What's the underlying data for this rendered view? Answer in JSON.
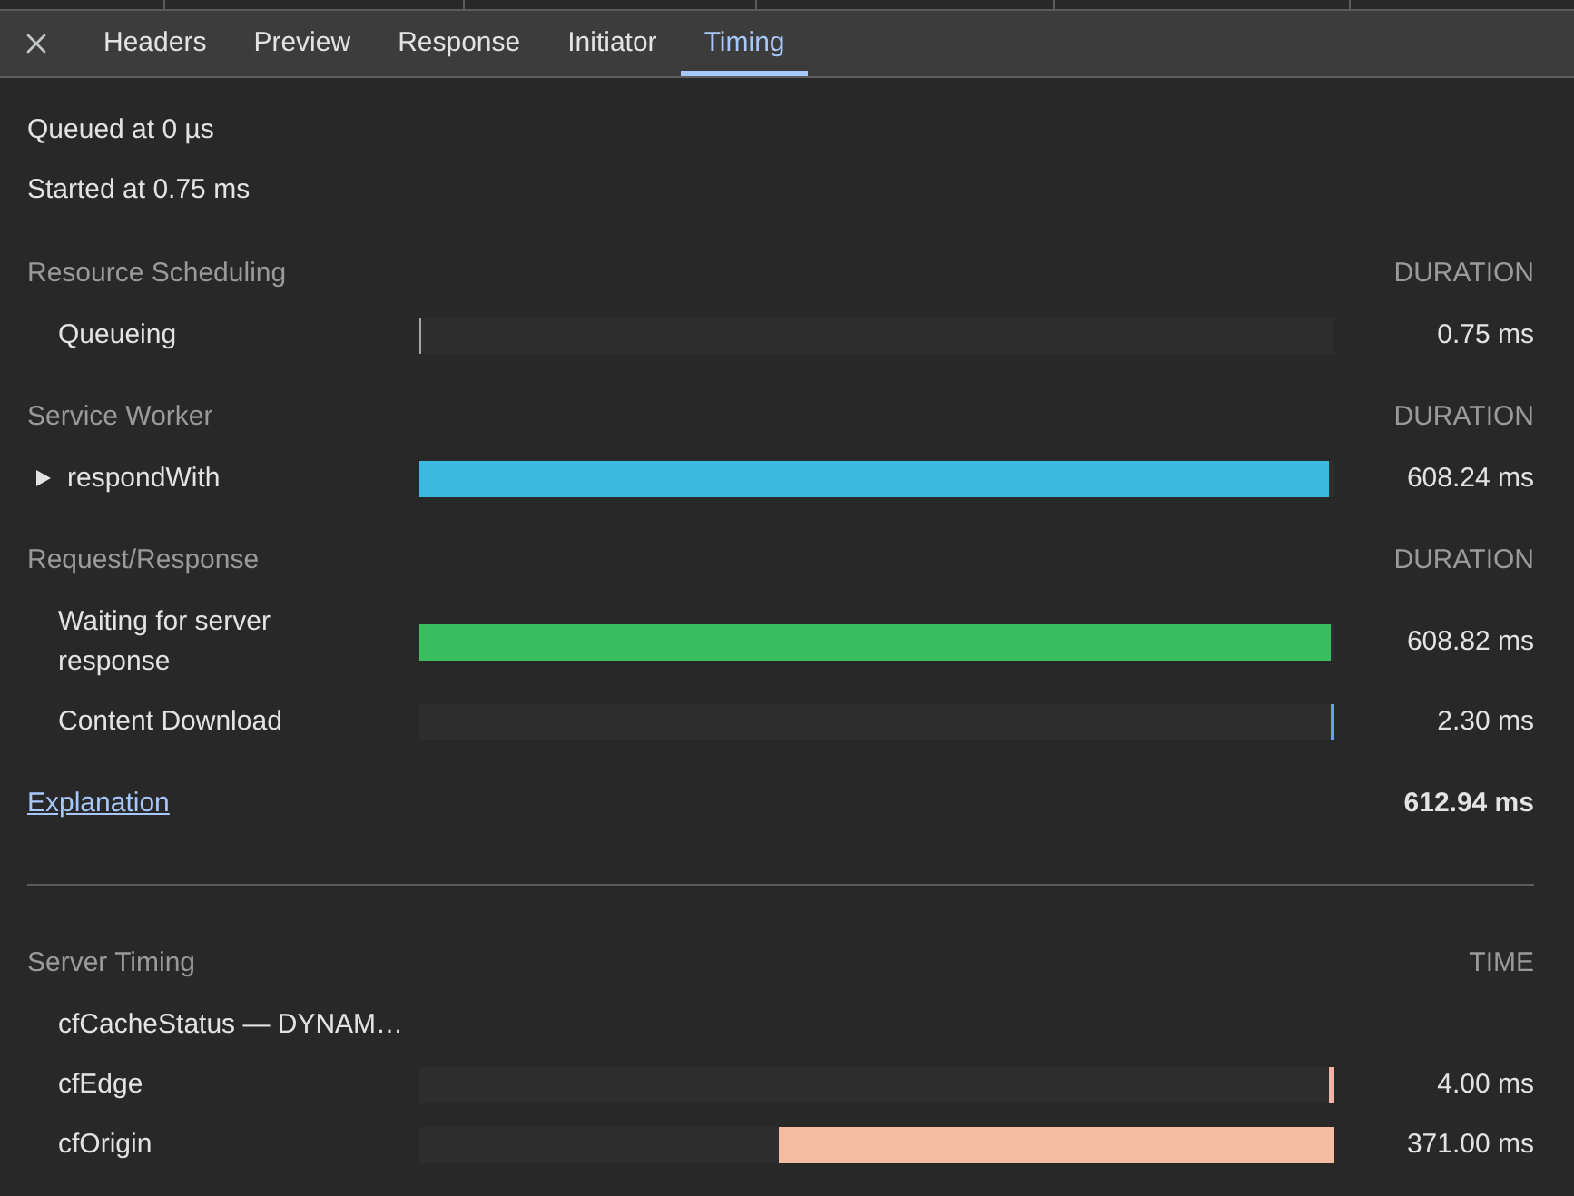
{
  "tabs": [
    {
      "label": "Headers",
      "selected": false
    },
    {
      "label": "Preview",
      "selected": false
    },
    {
      "label": "Response",
      "selected": false
    },
    {
      "label": "Initiator",
      "selected": false
    },
    {
      "label": "Timing",
      "selected": true
    }
  ],
  "summary": [
    "Queued at 0 µs",
    "Started at 0.75 ms"
  ],
  "sections": [
    {
      "title": "Resource Scheduling",
      "column_label": "DURATION",
      "rows": [
        {
          "label": "Queueing",
          "kind": "leading",
          "level": 0.001,
          "color": "#a6a6a6",
          "value": "0.75 ms"
        }
      ]
    },
    {
      "title": "Service Worker",
      "column_label": "DURATION",
      "rows": [
        {
          "label": "respondWith",
          "kind": "leading",
          "expanded": false,
          "level": 0.994,
          "color": "#3bb9e0",
          "value": "608.24 ms"
        }
      ]
    },
    {
      "title": "Request/Response",
      "column_label": "DURATION",
      "rows": [
        {
          "label": "Waiting for server response",
          "kind": "leading",
          "level": 0.996,
          "color": "#39bf60",
          "value": "608.82 ms"
        },
        {
          "label": "Content Download",
          "kind": "trailing",
          "level": 0.004,
          "color": "#6a9ff0",
          "value": "2.30 ms"
        }
      ]
    }
  ],
  "total": {
    "link": "Explanation",
    "value": "612.94 ms"
  },
  "server_timing": {
    "title": "Server Timing",
    "column_label": "TIME",
    "rows": [
      {
        "label": "cfCacheStatus — DYNAM…"
      },
      {
        "label": "cfEdge",
        "kind": "trailing",
        "level": 0.006,
        "color": "#f2b2a6",
        "value": "4.00 ms"
      },
      {
        "label": "cfOrigin",
        "kind": "trailing",
        "level": 0.607,
        "color": "#f4bda1",
        "value": "371.00 ms"
      }
    ]
  }
}
